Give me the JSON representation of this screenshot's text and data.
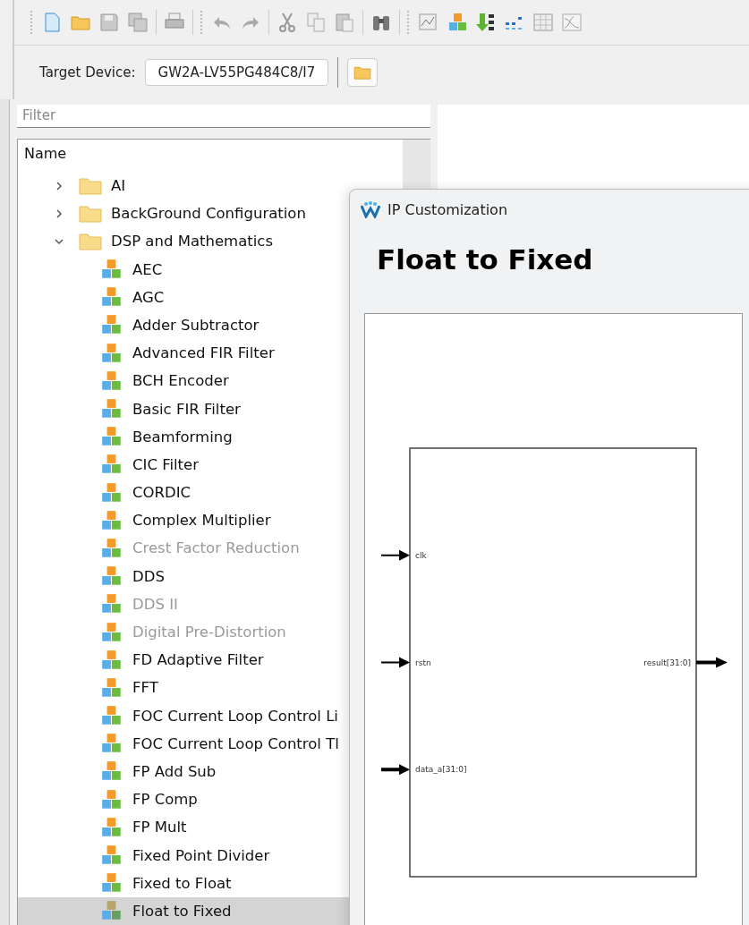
{
  "toolbar": {
    "target_device_label": "Target Device:",
    "target_device": "GW2A-LV55PG484C8/I7"
  },
  "filter": {
    "placeholder": "Filter"
  },
  "tree": {
    "header": "Name",
    "items": [
      {
        "label": "AI",
        "expanded": false
      },
      {
        "label": "BackGround Configuration",
        "expanded": false
      },
      {
        "label": "DSP and Mathematics",
        "expanded": true,
        "children": [
          {
            "label": "AEC",
            "disabled": false,
            "selected": false
          },
          {
            "label": "AGC",
            "disabled": false,
            "selected": false
          },
          {
            "label": "Adder Subtractor",
            "disabled": false,
            "selected": false
          },
          {
            "label": "Advanced FIR Filter",
            "disabled": false,
            "selected": false
          },
          {
            "label": "BCH Encoder",
            "disabled": false,
            "selected": false
          },
          {
            "label": "Basic FIR Filter",
            "disabled": false,
            "selected": false
          },
          {
            "label": "Beamforming",
            "disabled": false,
            "selected": false
          },
          {
            "label": "CIC Filter",
            "disabled": false,
            "selected": false
          },
          {
            "label": "CORDIC",
            "disabled": false,
            "selected": false
          },
          {
            "label": "Complex Multiplier",
            "disabled": false,
            "selected": false
          },
          {
            "label": "Crest Factor Reduction",
            "disabled": true,
            "selected": false
          },
          {
            "label": "DDS",
            "disabled": false,
            "selected": false
          },
          {
            "label": "DDS II",
            "disabled": true,
            "selected": false
          },
          {
            "label": "Digital Pre-Distortion",
            "disabled": true,
            "selected": false
          },
          {
            "label": "FD Adaptive Filter",
            "disabled": false,
            "selected": false
          },
          {
            "label": "FFT",
            "disabled": false,
            "selected": false
          },
          {
            "label": "FOC Current Loop Control Li",
            "disabled": false,
            "selected": false
          },
          {
            "label": "FOC Current Loop Control Tl",
            "disabled": false,
            "selected": false
          },
          {
            "label": "FP Add Sub",
            "disabled": false,
            "selected": false
          },
          {
            "label": "FP Comp",
            "disabled": false,
            "selected": false
          },
          {
            "label": "FP Mult",
            "disabled": false,
            "selected": false
          },
          {
            "label": "Fixed Point Divider",
            "disabled": false,
            "selected": false
          },
          {
            "label": "Fixed to Float",
            "disabled": false,
            "selected": false
          },
          {
            "label": "Float to Fixed",
            "disabled": false,
            "selected": true
          }
        ]
      }
    ]
  },
  "dialog": {
    "title": "IP Customization",
    "heading": "Float to Fixed",
    "ports": [
      {
        "name": "clk",
        "kind": "input",
        "bus": false
      },
      {
        "name": "rstn",
        "kind": "input",
        "bus": false
      },
      {
        "name": "data_a[31:0]",
        "kind": "input",
        "bus": true
      },
      {
        "name": "result[31:0]",
        "kind": "output",
        "bus": true
      }
    ]
  }
}
